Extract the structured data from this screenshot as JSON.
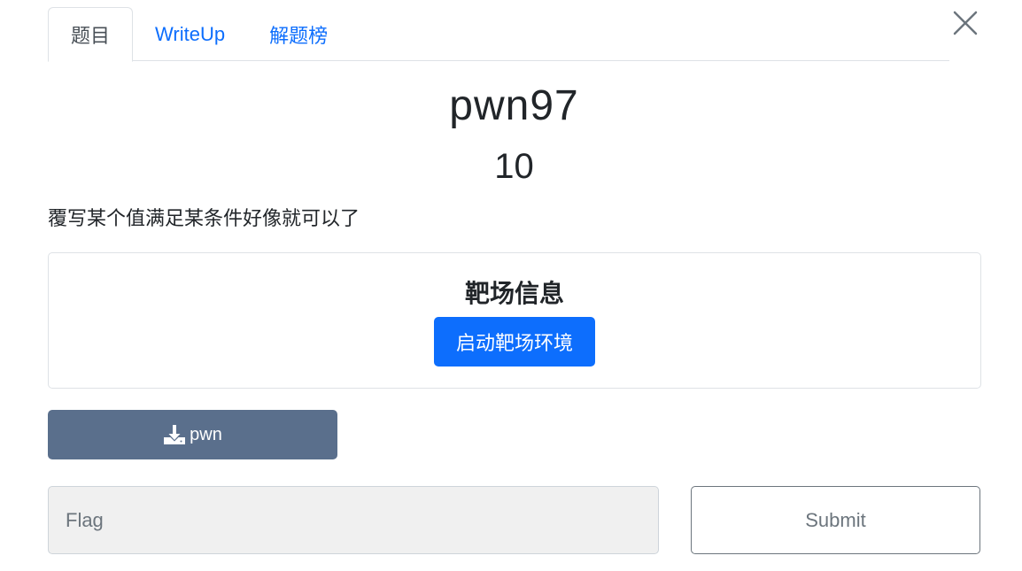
{
  "tabs": [
    {
      "label": "题目",
      "active": true
    },
    {
      "label": "WriteUp",
      "active": false
    },
    {
      "label": "解题榜",
      "active": false
    }
  ],
  "close_icon": "close-icon",
  "challenge": {
    "name": "pwn97",
    "points": "10",
    "description": "覆写某个值满足某条件好像就可以了"
  },
  "range_info": {
    "title": "靶场信息",
    "start_button": "启动靶场环境"
  },
  "download": {
    "icon": "download-icon",
    "label": "pwn"
  },
  "flag_form": {
    "placeholder": "Flag",
    "value": "",
    "submit_label": "Submit"
  },
  "colors": {
    "primary": "#0d6efd",
    "download_bg": "#5a6f8c",
    "input_bg": "#f0f0f0",
    "tab_inactive_text": "#0d6efd"
  }
}
